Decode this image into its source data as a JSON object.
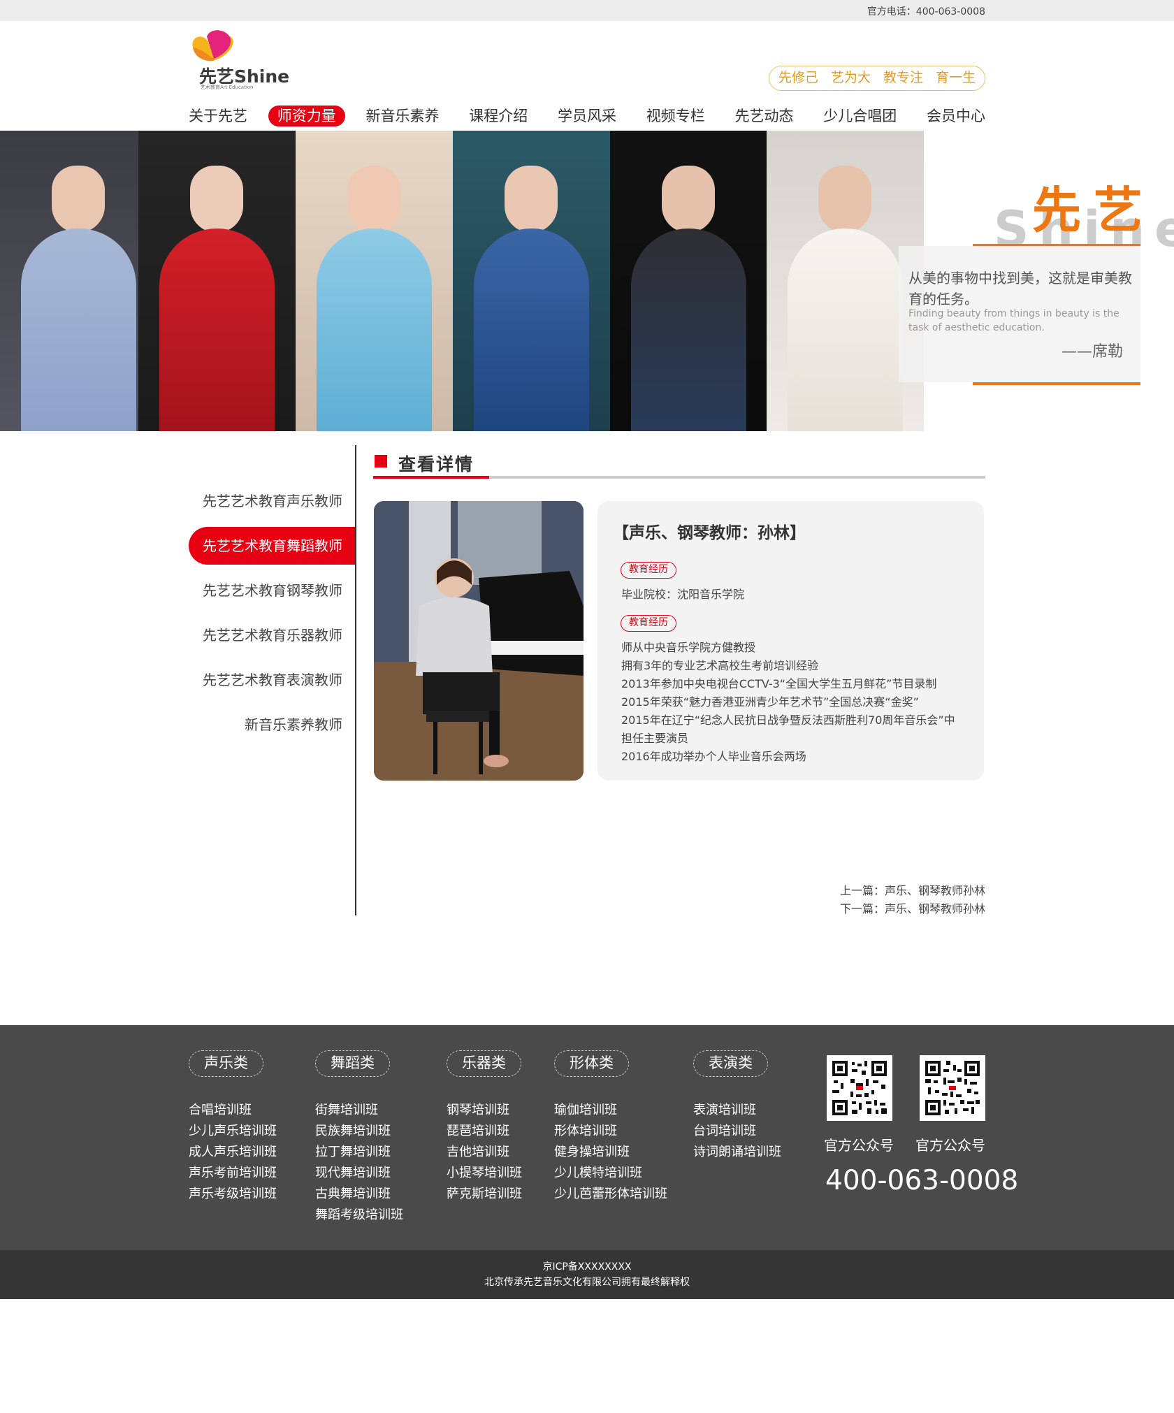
{
  "top": {
    "phone": "官方电话：400-063-0008"
  },
  "logo": {
    "brand": "先艺Shine",
    "sub": "艺术教育Art Education"
  },
  "slogan": [
    "先修己",
    "艺为大",
    "教专注",
    "育一生"
  ],
  "nav": [
    "关于先艺",
    "师资力量",
    "新音乐素养",
    "课程介绍",
    "学员风采",
    "视频专栏",
    "先艺动态",
    "少儿合唱团",
    "会员中心"
  ],
  "banner": {
    "title": "先艺",
    "shine": "Shine",
    "quote_zh": "从美的事物中找到美，这就是审美教育的任务。",
    "quote_en": "Finding beauty from things in beauty is the task of aesthetic education.",
    "author": "——席勒"
  },
  "sidebar": [
    "先艺艺术教育声乐教师",
    "先艺艺术教育舞蹈教师",
    "先艺艺术教育钢琴教师",
    "先艺艺术教育乐器教师",
    "先艺艺术教育表演教师",
    "新音乐素养教师"
  ],
  "section": {
    "title": "查看详情"
  },
  "teacher": {
    "title": "【声乐、钢琴教师：孙林】",
    "tag1": "教育经历",
    "school": "毕业院校：沈阳音乐学院",
    "tag2": "教育经历",
    "lines": [
      "师从中央音乐学院方健教授",
      "拥有3年的专业艺术高校生考前培训经验",
      "2013年参加中央电视台CCTV-3“全国大学生五月鲜花”节目录制",
      "2015年荣获“魅力香港亚洲青少年艺术节”全国总决赛“金奖”",
      "2015年在辽宁“纪念人民抗日战争暨反法西斯胜利70周年音乐会”中",
      "担任主要演员",
      "2016年成功举办个人毕业音乐会两场"
    ]
  },
  "pager": {
    "prev": "上一篇：声乐、钢琴教师孙林",
    "next": "下一篇：声乐、钢琴教师孙林"
  },
  "footer": {
    "columns": [
      {
        "cat": "声乐类",
        "links": [
          "合唱培训班",
          "少儿声乐培训班",
          "成人声乐培训班",
          "声乐考前培训班",
          "声乐考级培训班"
        ]
      },
      {
        "cat": "舞蹈类",
        "links": [
          "街舞培训班",
          "民族舞培训班",
          "拉丁舞培训班",
          "现代舞培训班",
          "古典舞培训班",
          "舞蹈考级培训班"
        ]
      },
      {
        "cat": "乐器类",
        "links": [
          "钢琴培训班",
          "琵琶培训班",
          "吉他培训班",
          "小提琴培训班",
          "萨克斯培训班"
        ]
      },
      {
        "cat": "形体类",
        "links": [
          "瑜伽培训班",
          "形体培训班",
          "健身操培训班",
          "少儿模特培训班",
          "少儿芭蕾形体培训班"
        ]
      },
      {
        "cat": "表演类",
        "links": [
          "表演培训班",
          "台词培训班",
          "诗词朗诵培训班"
        ]
      }
    ],
    "qr1": "官方公众号",
    "qr2": "官方公众号",
    "phone": "400-063-0008"
  },
  "copyright": {
    "icp": "京ICP备XXXXXXXX",
    "company": "北京传承先艺音乐文化有限公司拥有最终解释权"
  },
  "colors": {
    "brand_red": "#e60012",
    "orange": "#ec7713",
    "slogan_gold": "#e99a17",
    "footer_bg": "#4a4a4a"
  }
}
